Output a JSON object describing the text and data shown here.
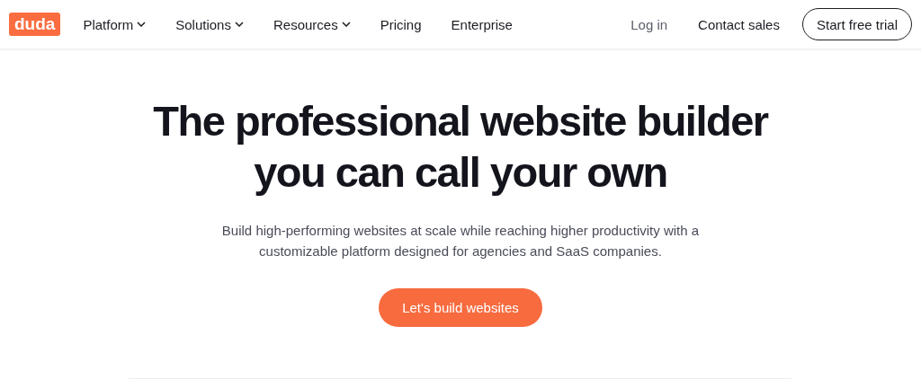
{
  "header": {
    "logo": "duda",
    "nav": [
      {
        "label": "Platform",
        "dropdown": true
      },
      {
        "label": "Solutions",
        "dropdown": true
      },
      {
        "label": "Resources",
        "dropdown": true
      },
      {
        "label": "Pricing",
        "dropdown": false
      },
      {
        "label": "Enterprise",
        "dropdown": false
      }
    ],
    "login": "Log in",
    "contact": "Contact sales",
    "trial_button": "Start free trial"
  },
  "hero": {
    "headline": [
      "The professional website builder",
      "you can call your own"
    ],
    "subtitle": [
      "Build high-performing websites at scale while reaching higher productivity with a",
      "customizable platform designed for agencies and SaaS companies."
    ],
    "cta": "Let's build websites"
  }
}
